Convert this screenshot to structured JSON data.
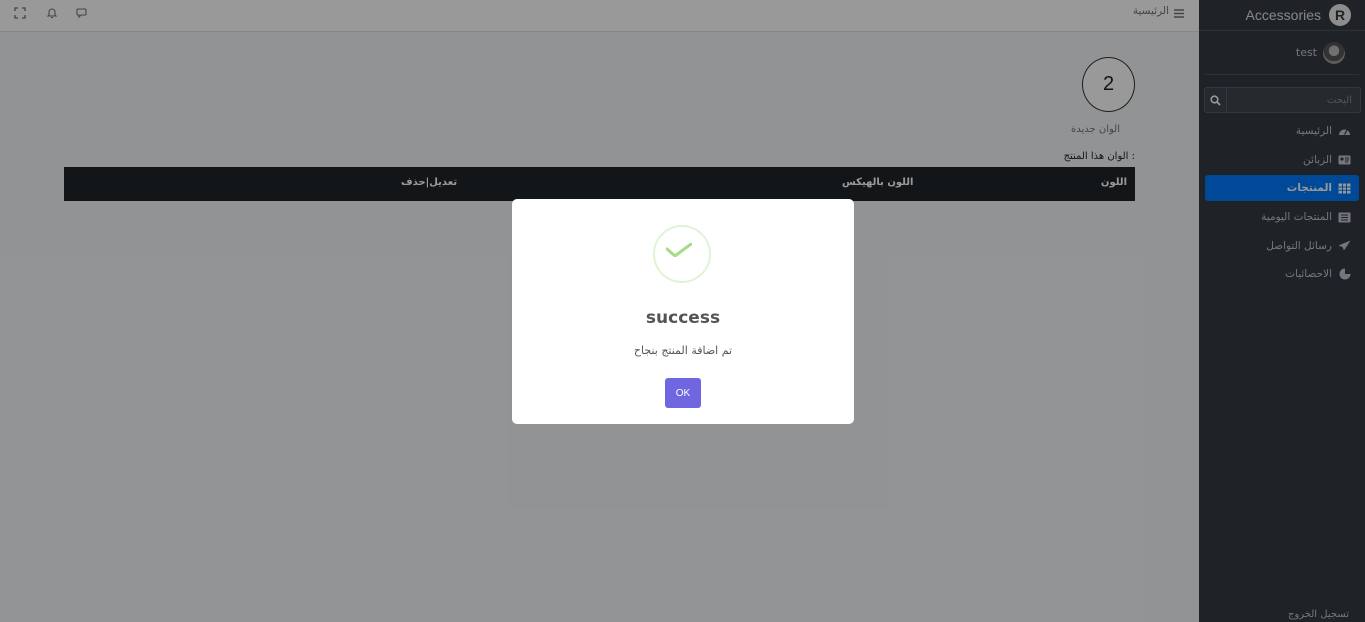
{
  "sidebar": {
    "brand": "Accessories",
    "brand_logo_letter": "R",
    "user_name": "test",
    "search_placeholder": "البحث",
    "items": [
      {
        "label": "الرئيسية",
        "icon": "tachometer-icon",
        "active": false
      },
      {
        "label": "الزبائن",
        "icon": "id-card-icon",
        "active": false
      },
      {
        "label": "المنتجات",
        "icon": "table-icon",
        "active": true
      },
      {
        "label": "المنتجات اليومية",
        "icon": "list-icon",
        "active": false
      },
      {
        "label": "رسائل التواصل",
        "icon": "paper-plane-icon",
        "active": false
      },
      {
        "label": "الاحصائيات",
        "icon": "pie-chart-icon",
        "active": false
      }
    ],
    "logout": "تسجيل الخروج"
  },
  "topbar": {
    "home_link": "الرئيسية"
  },
  "content": {
    "counter_value": "2",
    "counter_label": "الوان جديدة",
    "table_title": "الوان هذا المنتج :",
    "table_headers": [
      "اللون",
      "اللون بالهيكس",
      "تعديل|حذف"
    ]
  },
  "modal": {
    "title": "success",
    "message": "تم اضافة المنتج بنجاح",
    "ok_label": "OK",
    "icon_color": "#a5dc86",
    "button_color": "#7066e0"
  },
  "colors": {
    "sidebar_bg": "#343a40",
    "active_item": "#007bff",
    "table_header_bg": "#212529"
  }
}
